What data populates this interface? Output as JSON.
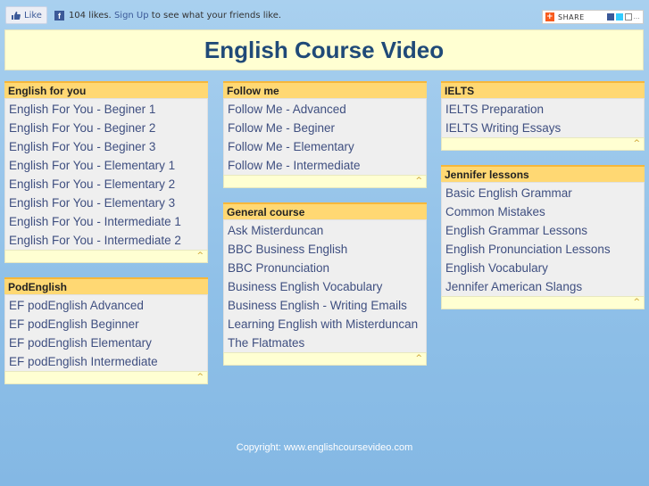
{
  "fb": {
    "like_label": "Like",
    "likes_text": "104 likes.",
    "signup_link": "Sign Up",
    "signup_suffix": "to see what your friends like."
  },
  "share": {
    "label": "SHARE"
  },
  "header": {
    "title": "English Course Video"
  },
  "boxes": {
    "english_for_you": {
      "title": "English for you",
      "items": [
        "English For You - Beginer 1",
        "English For You - Beginer 2",
        "English For You - Beginer 3",
        "English For You - Elementary 1",
        "English For You - Elementary 2",
        "English For You - Elementary 3",
        "English For You - Intermediate 1",
        "English For You - Intermediate 2"
      ]
    },
    "podenglish": {
      "title": "PodEnglish",
      "items": [
        "EF podEnglish Advanced",
        "EF podEnglish Beginner",
        "EF podEnglish Elementary",
        "EF podEnglish Intermediate"
      ]
    },
    "follow_me": {
      "title": "Follow me",
      "items": [
        "Follow Me - Advanced",
        "Follow Me - Beginer",
        "Follow Me - Elementary",
        "Follow Me - Intermediate"
      ]
    },
    "general_course": {
      "title": "General course",
      "items": [
        "Ask Misterduncan",
        "BBC Business English",
        "BBC Pronunciation",
        "Business English Vocabulary",
        "Business English - Writing Emails",
        "Learning English with Misterduncan",
        "The Flatmates"
      ]
    },
    "ielts": {
      "title": "IELTS",
      "items": [
        "IELTS Preparation",
        "IELTS Writing Essays"
      ]
    },
    "jennifer": {
      "title": "Jennifer lessons",
      "items": [
        "Basic English Grammar",
        "Common Mistakes",
        "English Grammar Lessons",
        "English Pronunciation Lessons",
        "English Vocabulary",
        "Jennifer American Slangs"
      ]
    }
  },
  "footer": {
    "copyright": "Copyright: www.englishcoursevideo.com"
  },
  "colors": {
    "header_bg": "#ffffd2",
    "title_bar": "#ffd873",
    "link": "#3f4f80",
    "page_bg": "#a9d0ef"
  }
}
